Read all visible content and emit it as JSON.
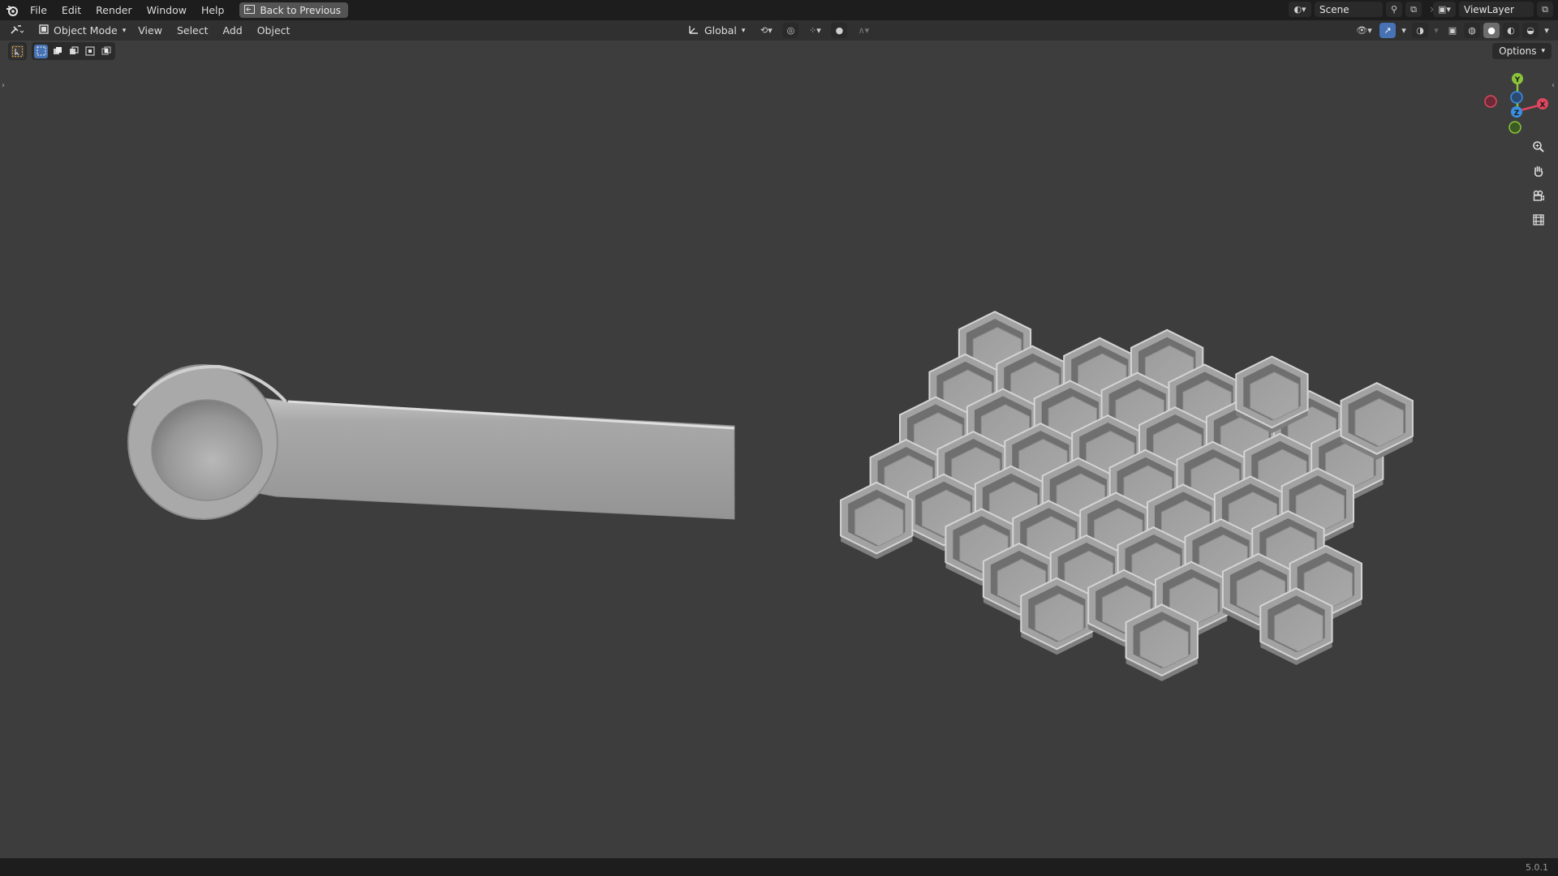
{
  "app": {
    "menus": [
      "File",
      "Edit",
      "Render",
      "Window",
      "Help"
    ],
    "back_button": "Back to Previous"
  },
  "scene": {
    "label": "Scene"
  },
  "view_layer": {
    "label": "ViewLayer"
  },
  "header": {
    "mode": "Object Mode",
    "menus": [
      "View",
      "Select",
      "Add",
      "Object"
    ],
    "transform_orientation": "Global"
  },
  "viewport": {
    "options_label": "Options",
    "model_color": "#a2a2a2",
    "background_color": "#3d3d3d"
  },
  "gizmo": {
    "axes": [
      "Y",
      "Z",
      "X"
    ],
    "colors": {
      "x": "#e0465e",
      "y": "#8bc43a",
      "z": "#3b8fe0"
    }
  },
  "nav_icons": [
    "zoom-icon",
    "hand-pan-icon",
    "camera-icon",
    "ortho-grid-icon"
  ],
  "status": {
    "version": "5.0.1"
  }
}
